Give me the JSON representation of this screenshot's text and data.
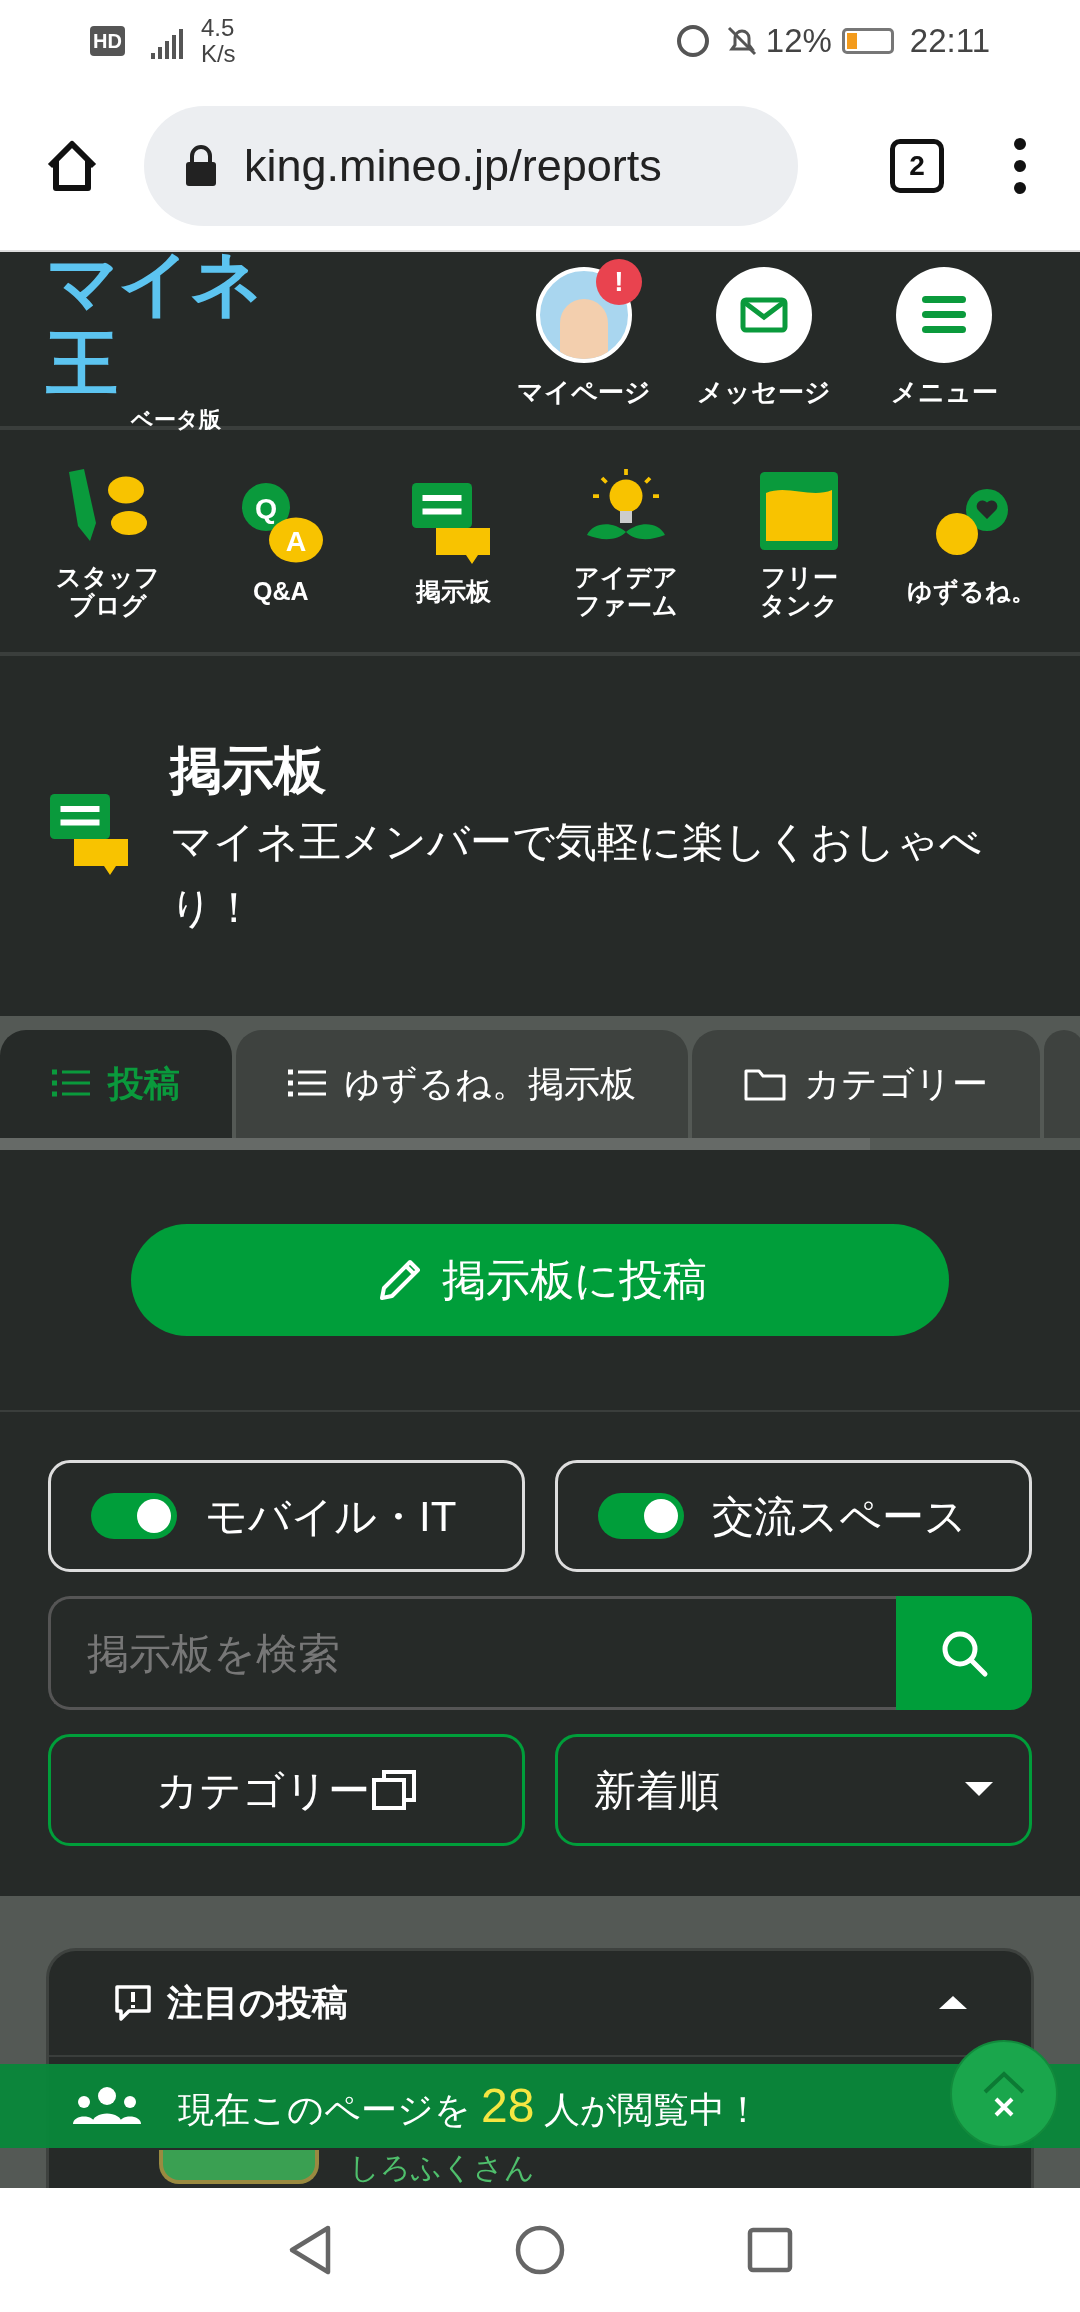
{
  "status_bar": {
    "hd_label": "HD",
    "network_speed": "4.5",
    "speed_unit": "K/s",
    "battery": "12%",
    "time": "22:11"
  },
  "browser": {
    "url": "king.mineo.jp/reports",
    "tab_count": "2"
  },
  "header": {
    "logo": "マイネ王",
    "logo_subtitle": "ベータ版",
    "actions": [
      {
        "kind": "avatar",
        "label": "マイページ",
        "badge": "!"
      },
      {
        "kind": "mail",
        "label": "メッセージ"
      },
      {
        "kind": "menu",
        "label": "メニュー"
      }
    ]
  },
  "nav": [
    {
      "kind": "blog",
      "label_lines": [
        "スタッフ",
        "ブログ"
      ]
    },
    {
      "kind": "qa",
      "label_lines": [
        "Q&A"
      ],
      "q": "Q",
      "a": "A"
    },
    {
      "kind": "board",
      "label_lines": [
        "掲示板"
      ]
    },
    {
      "kind": "idea",
      "label_lines": [
        "アイデア",
        "ファーム"
      ]
    },
    {
      "kind": "tank",
      "label_lines": [
        "フリー",
        "タンク"
      ]
    },
    {
      "kind": "yuzurune",
      "label_lines": [
        "ゆずるね。"
      ]
    }
  ],
  "hero": {
    "title": "掲示板",
    "subtitle": "マイネ王メンバーで気軽に楽しくおしゃべり！"
  },
  "tabs": [
    {
      "kind": "list",
      "label": "投稿",
      "selected": true
    },
    {
      "kind": "list",
      "label": "ゆずるね。掲示板",
      "selected": false
    },
    {
      "kind": "folder",
      "label": "カテゴリー",
      "selected": false
    }
  ],
  "post_button": "掲示板に投稿",
  "filters": [
    {
      "label": "モバイル・IT",
      "on": true
    },
    {
      "label": "交流スペース",
      "on": true
    }
  ],
  "search": {
    "placeholder": "掲示板を検索"
  },
  "category_button": "カテゴリー",
  "sort": {
    "value": "新着順"
  },
  "featured": {
    "title": "注目の投稿",
    "expanded": true,
    "first_author": "しろふくさん"
  },
  "viewer_banner": {
    "text_before": "現在このページを",
    "count": "28",
    "text_after": "人が閲覧中！"
  }
}
